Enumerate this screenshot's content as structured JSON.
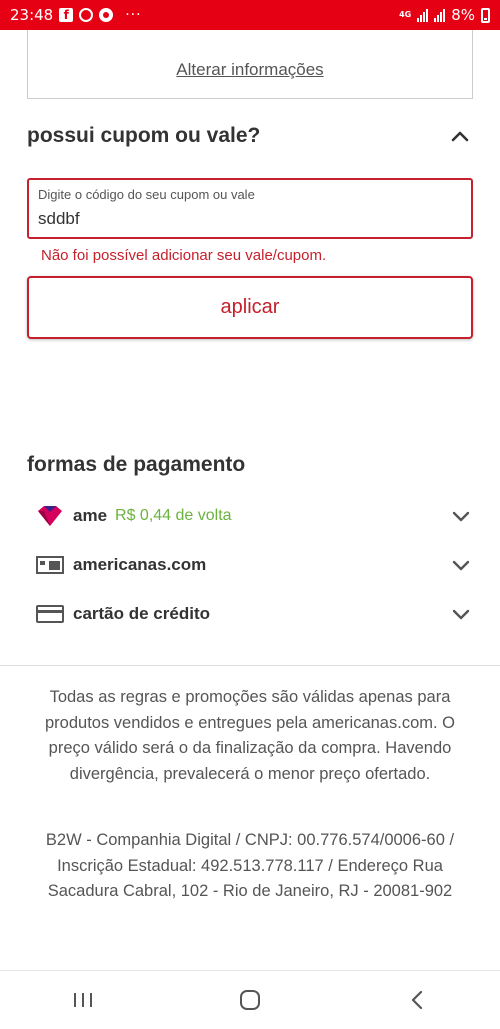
{
  "status_bar": {
    "time": "23:48",
    "more": "···",
    "network": "4G",
    "battery": "8%",
    "icons": [
      "facebook-icon",
      "whatsapp-icon",
      "chrome-icon",
      "signal-icon",
      "battery-icon"
    ]
  },
  "info_box": {
    "link": "Alterar informações"
  },
  "coupon": {
    "title": "possui cupom ou vale?",
    "field_label": "Digite o código do seu cupom ou vale",
    "value": "sddbf",
    "error": "Não foi possível adicionar seu vale/cupom.",
    "apply_label": "aplicar"
  },
  "payment": {
    "title": "formas de pagamento",
    "methods": [
      {
        "label": "ame",
        "cashback": "R$ 0,44 de volta",
        "icon": "ame-heart-icon"
      },
      {
        "label": "americanas.com",
        "icon": "voucher-card-icon"
      },
      {
        "label": "cartão de crédito",
        "icon": "credit-card-icon"
      }
    ]
  },
  "footer": {
    "disclaimer": "Todas as regras e promoções são válidas apenas para produtos vendidos e entregues pela americanas.com. O preço válido será o da finalização da compra. Havendo divergência, prevalecerá o menor preço ofertado.",
    "company": "B2W - Companhia Digital / CNPJ: 00.776.574/0006-60 / Inscrição Estadual: 492.513.778.117 / Endereço Rua Sacadura Cabral, 102 - Rio de Janeiro, RJ - 20081-902"
  },
  "colors": {
    "brand_red": "#e60014",
    "error_red": "#c5212c",
    "cashback_green": "#6db33f",
    "ame_pink": "#d6005c"
  }
}
